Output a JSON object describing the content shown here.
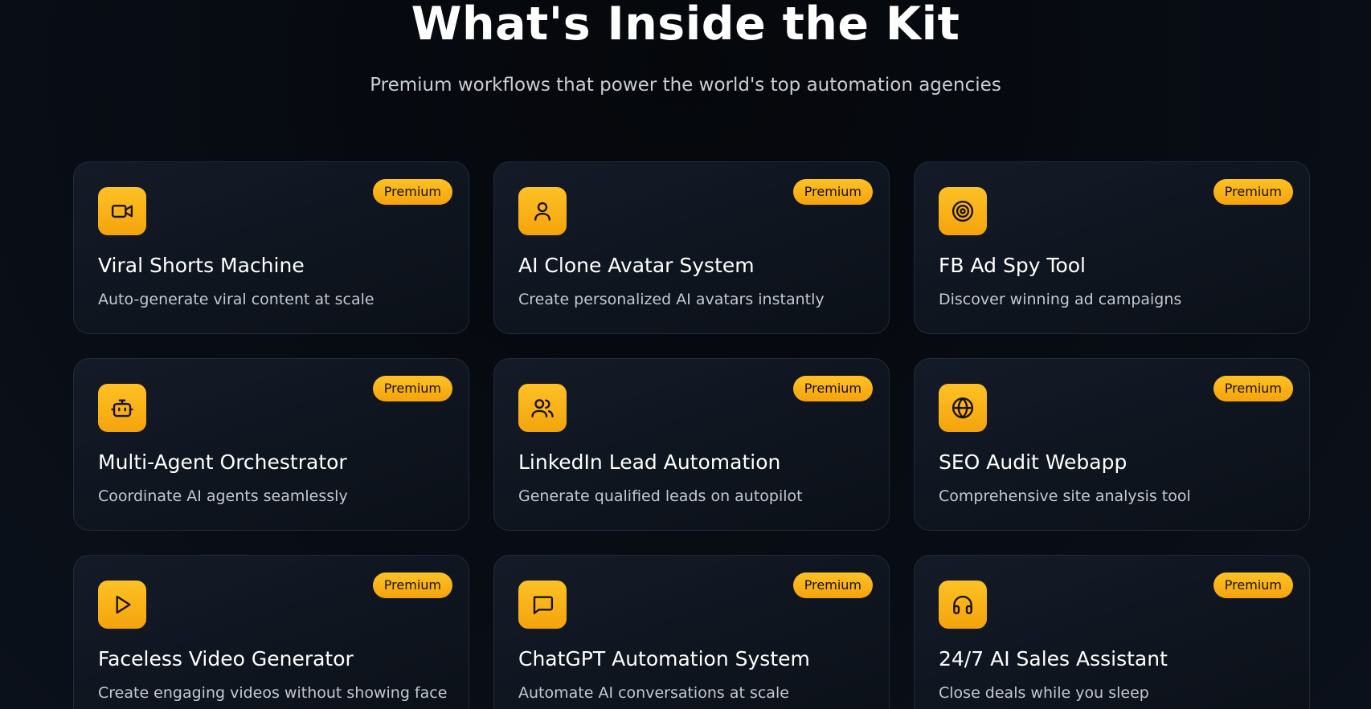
{
  "section": {
    "title": "What's Inside the Kit",
    "subtitle": "Premium workflows that power the world's top automation agencies"
  },
  "colors": {
    "accent": "#fbb917",
    "card_background": "#111823",
    "page_background": "#070b12"
  },
  "cards": [
    {
      "icon": "video-camera-icon",
      "badge": "Premium",
      "title": "Viral Shorts Machine",
      "description": "Auto-generate viral content at scale"
    },
    {
      "icon": "user-icon",
      "badge": "Premium",
      "title": "AI Clone Avatar System",
      "description": "Create personalized AI avatars instantly"
    },
    {
      "icon": "target-icon",
      "badge": "Premium",
      "title": "FB Ad Spy Tool",
      "description": "Discover winning ad campaigns"
    },
    {
      "icon": "robot-icon",
      "badge": "Premium",
      "title": "Multi-Agent Orchestrator",
      "description": "Coordinate AI agents seamlessly"
    },
    {
      "icon": "users-icon",
      "badge": "Premium",
      "title": "LinkedIn Lead Automation",
      "description": "Generate qualified leads on autopilot"
    },
    {
      "icon": "globe-icon",
      "badge": "Premium",
      "title": "SEO Audit Webapp",
      "description": "Comprehensive site analysis tool"
    },
    {
      "icon": "play-icon",
      "badge": "Premium",
      "title": "Faceless Video Generator",
      "description": "Create engaging videos without showing face"
    },
    {
      "icon": "chat-bubble-icon",
      "badge": "Premium",
      "title": "ChatGPT Automation System",
      "description": "Automate AI conversations at scale"
    },
    {
      "icon": "headphones-icon",
      "badge": "Premium",
      "title": "24/7 AI Sales Assistant",
      "description": "Close deals while you sleep"
    }
  ]
}
